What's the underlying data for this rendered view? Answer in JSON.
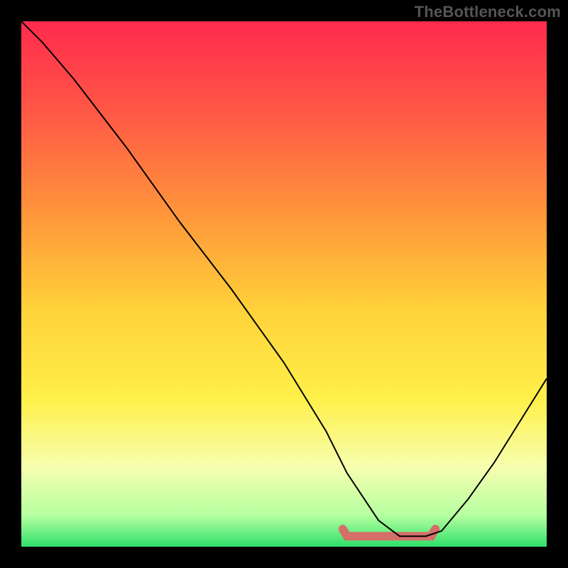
{
  "watermark": "TheBottleneck.com",
  "chart_data": {
    "type": "line",
    "title": "",
    "xlabel": "",
    "ylabel": "",
    "xlim": [
      0,
      100
    ],
    "ylim": [
      0,
      100
    ],
    "grid": false,
    "background": "rainbow-vertical-gradient",
    "gradient_stops": [
      {
        "pct": 0,
        "color": "#ff2a4d"
      },
      {
        "pct": 18,
        "color": "#ff5a45"
      },
      {
        "pct": 38,
        "color": "#ff9a3a"
      },
      {
        "pct": 55,
        "color": "#ffd23a"
      },
      {
        "pct": 72,
        "color": "#fff04a"
      },
      {
        "pct": 85,
        "color": "#f6ffb0"
      },
      {
        "pct": 94,
        "color": "#b6ffa0"
      },
      {
        "pct": 100,
        "color": "#2fe06a"
      }
    ],
    "series": [
      {
        "name": "bottleneck-curve",
        "x": [
          0,
          4,
          10,
          20,
          30,
          40,
          50,
          58,
          62,
          68,
          72,
          77,
          80,
          85,
          90,
          95,
          100
        ],
        "values": [
          100,
          96,
          89,
          76,
          62,
          49,
          35,
          22,
          14,
          5,
          2,
          2,
          3,
          9,
          16,
          24,
          32
        ]
      }
    ],
    "highlight_segment": {
      "x_start": 62,
      "x_end": 78,
      "y": 2,
      "color": "#d66e6a"
    }
  }
}
